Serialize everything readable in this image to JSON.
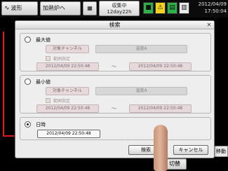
{
  "topbar": {
    "waveform_label": "波形",
    "hold_label": "加熱炉ヘ",
    "status_line1": "収集中",
    "status_line2": "12day22h",
    "date": "2012/04/09",
    "time": "17:50:04"
  },
  "dialog": {
    "title": "検索",
    "max_group": {
      "label": "最大値",
      "channel_button": "対象チャンネル",
      "channel_value": "温度A",
      "range_checkbox_label": "範囲指定",
      "range_start": "2012/04/09 22:50:48",
      "range_end": "2012/04/09 22:50:48",
      "separator": "～"
    },
    "min_group": {
      "label": "最小値",
      "channel_button": "対象チャンネル",
      "channel_value": "温度A",
      "range_checkbox_label": "範囲指定",
      "range_start": "2012/04/09 22:50:48",
      "range_end": "2012/04/09 22:50:48",
      "separator": "～"
    },
    "datetime_group": {
      "label": "日時",
      "value": "2012/04/09 22:50:48"
    },
    "search_button": "検索",
    "cancel_button": "キャンセル"
  },
  "background": {
    "side_button": "移動",
    "bottom_button": "切替"
  }
}
